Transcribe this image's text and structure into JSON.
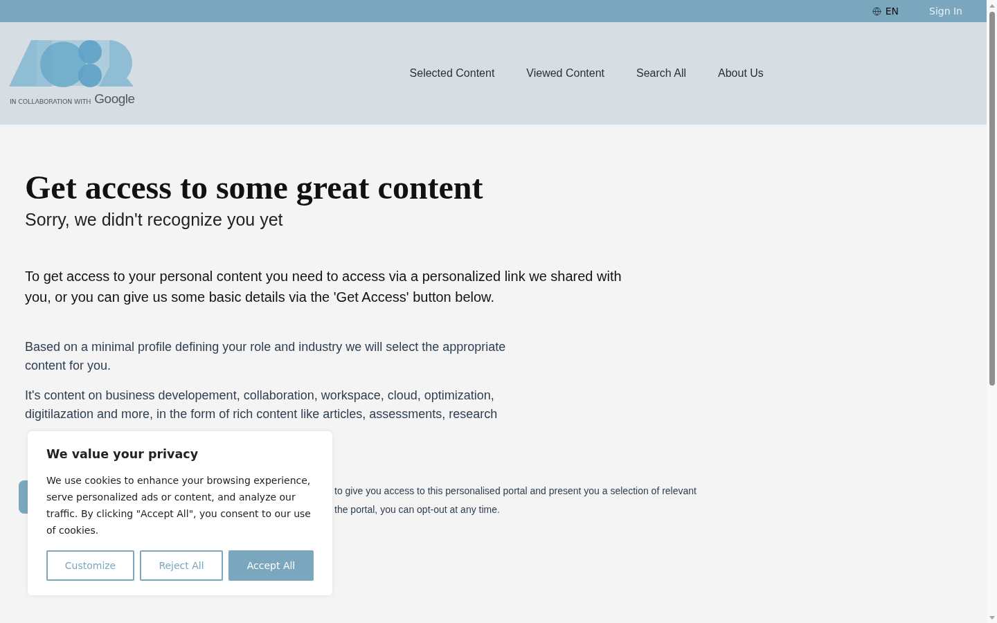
{
  "top_bar": {
    "language": "EN",
    "sign_in": "Sign In"
  },
  "header": {
    "logo": {
      "tagline": "IN COLLABORATION WITH",
      "partner": "Google"
    },
    "nav": [
      {
        "label": "Selected Content"
      },
      {
        "label": "Viewed Content"
      },
      {
        "label": "Search All"
      },
      {
        "label": "About Us"
      }
    ]
  },
  "main": {
    "title": "Get access to some great content",
    "subtitle": "Sorry, we didn't recognize you yet",
    "intro": "To get access to your personal content you need to access via a personalized link we shared with you, or you can give us some basic details via the 'Get Access' button below.",
    "paragraphs": [
      "Based on a minimal profile defining your role and industry we will select the appropriate content for you.",
      "It's content on business developement, collaboration, workspace, cloud, optimization, digitilazation and more, in the form of rich content like articles, assessments, research"
    ],
    "consent_lines": [
      "to give you access to this personalised portal and present you a selection of relevant",
      "the portal, you can opt-out at any time."
    ]
  },
  "cookie_dialog": {
    "title": "We value your privacy",
    "body": "We use cookies to enhance your browsing experience, serve personalized ads or content, and analyze our traffic. By clicking \"Accept All\", you consent to our use of cookies.",
    "buttons": [
      {
        "label": "Customize",
        "kind": "outline"
      },
      {
        "label": "Reject All",
        "kind": "outline"
      },
      {
        "label": "Accept All",
        "kind": "primary"
      }
    ]
  }
}
